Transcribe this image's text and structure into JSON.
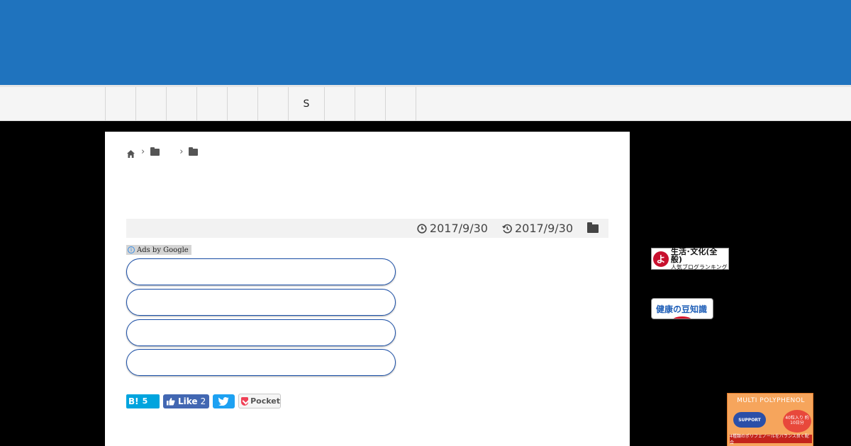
{
  "nav": {
    "items": [
      {
        "label": ""
      },
      {
        "label": ""
      },
      {
        "label": ""
      },
      {
        "label": ""
      },
      {
        "label": ""
      },
      {
        "label": ""
      },
      {
        "label": "S"
      },
      {
        "label": ""
      },
      {
        "label": ""
      },
      {
        "label": ""
      }
    ]
  },
  "breadcrumb": {
    "icons": [
      "home-icon",
      "folder-icon",
      "folder-icon"
    ]
  },
  "meta": {
    "published": "2017/9/30",
    "updated": "2017/9/30"
  },
  "ads": {
    "label": "Ads by Google",
    "info": "i"
  },
  "share": {
    "hatena_label": "B!",
    "hatena_count": "5",
    "like_label": "Like",
    "like_count": "2",
    "pocket_label": "Pocket"
  },
  "sidebar": {
    "ranking_banner": {
      "badge": "よ",
      "main": "生活･文化(全般)",
      "sub": "人気ブログランキング"
    },
    "mame_banner": {
      "text": "健康の豆知識"
    },
    "product": {
      "title": "MULTI  POLYPHENOL",
      "pill": "SUPPORT",
      "badge": "40粒入り 約10日分",
      "bar": "4種類のポリフェノールをバランス良く配合"
    }
  },
  "colors": {
    "header": "#1f73be",
    "nav_bg": "#f5f5f5",
    "ad_button_border": "#1a4fa8",
    "hatena": "#00a4de",
    "facebook": "#4267b2",
    "twitter": "#1da1f2",
    "pocket": "#ef4056"
  }
}
